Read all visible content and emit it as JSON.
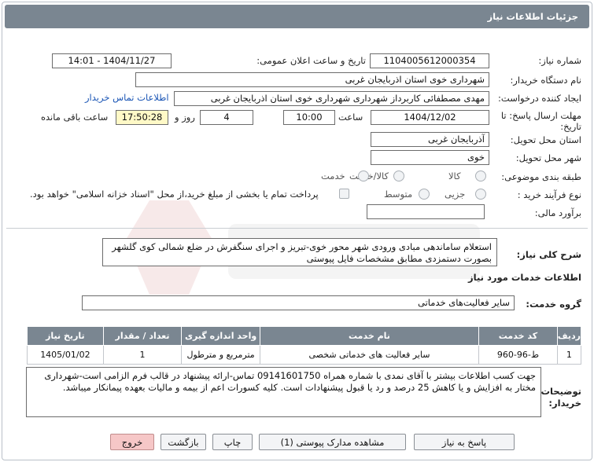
{
  "header": {
    "title": "جزئیات اطلاعات نیاز"
  },
  "fields": {
    "need_number_label": "شماره نیاز:",
    "need_number": "1104005612000354",
    "announce_label": "تاریخ و ساعت اعلان عمومی:",
    "announce_value": "1404/11/27 - 14:01",
    "buyer_org_label": "نام دستگاه خریدار:",
    "buyer_org": "شهرداری خوی استان اذربایجان غربی",
    "creator_label": "ایجاد کننده درخواست:",
    "creator": "مهدی مصطفائی کاربرداز شهرداری شهرداری خوی استان اذربایجان غربی",
    "contact_link": "اطلاعات تماس خریدار",
    "deadline_label": "مهلت ارسال پاسخ: تا تاریخ:",
    "deadline_date": "1404/12/02",
    "time_label": "ساعت",
    "deadline_time": "10:00",
    "days_value": "4",
    "days_label": "روز و",
    "remaining_time": "17:50:28",
    "remaining_label": "ساعت باقی مانده",
    "province_label": "استان محل تحویل:",
    "province": "آذربایجان غربی",
    "city_label": "شهر محل تحویل:",
    "city": "خوی",
    "category_label": "طبقه بندی موضوعی:",
    "category_options": [
      "کالا",
      "کالا/خدمت",
      "خدمت"
    ],
    "process_label": "نوع فرآیند خرید :",
    "process_options": [
      "جزیی",
      "متوسط"
    ],
    "payment_note": "پرداخت تمام یا بخشی از مبلغ خرید،از محل \"اسناد خزانه اسلامی\" خواهد بود.",
    "budget_label": "برآورد مالی:",
    "budget_value": ""
  },
  "description": {
    "label": "شرح کلی نیاز:",
    "text": "استعلام ساماندهی مبادی ورودی شهر محور خوی-تبریز و اجرای سنگفرش در ضلع شمالی کوی گلشهر بصورت دستمزدی مطابق مشخصات فایل پیوستی"
  },
  "services": {
    "section_title": "اطلاعات خدمات مورد نیاز",
    "group_label": "گروه خدمت:",
    "group_value": "سایر فعالیت‌های خدماتی",
    "table": {
      "headers": [
        "ردیف",
        "کد خدمت",
        "نام خدمت",
        "واحد اندازه گیری",
        "تعداد / مقدار",
        "تاریخ نیاز"
      ],
      "rows": [
        [
          "1",
          "ط-96-960",
          "سایر فعالیت های خدماتی شخصی",
          "مترمربع و مترطول",
          "1",
          "1405/01/02"
        ]
      ]
    }
  },
  "buyer_notes": {
    "label": "توضیحات خریدار:",
    "text": "جهت کسب اطلاعات بیشتر با آقای نمدی با شماره همراه 09141601750 تماس-ارائه پیشنهاد در قالب فرم الزامی است-شهرداری مختار به افزایش و یا کاهش 25 درصد و رد یا قبول پیشنهادات است. کلیه کسورات اعم از بیمه و مالیات بعهده پیمانکار میباشد."
  },
  "buttons": {
    "reply": "پاسخ به نیاز",
    "attachments": "مشاهده مدارک پیوستی (1)",
    "print": "چاپ",
    "back": "بازگشت",
    "exit": "خروج"
  },
  "colors": {
    "header_bg": "#7a8691",
    "remaining_bg": "#fff9c7",
    "exit_bg": "#f6c7c7",
    "link": "#1a55b5"
  }
}
